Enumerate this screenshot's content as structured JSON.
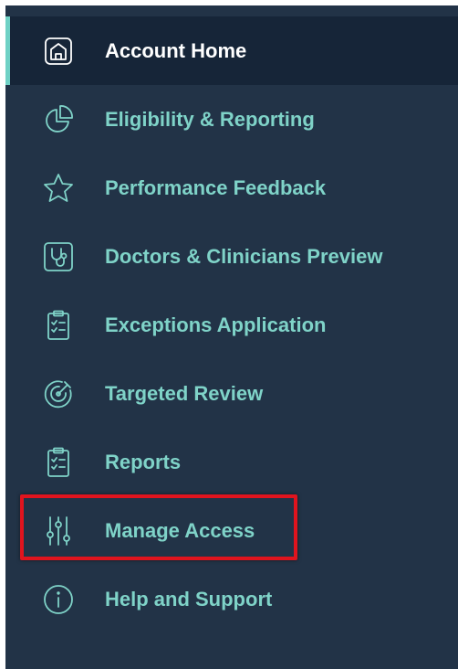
{
  "nav": {
    "items": [
      {
        "label": "Account Home",
        "icon": "home-icon",
        "active": true
      },
      {
        "label": "Eligibility & Reporting",
        "icon": "pie-chart-icon"
      },
      {
        "label": "Performance Feedback",
        "icon": "star-icon"
      },
      {
        "label": "Doctors & Clinicians Preview",
        "icon": "stethoscope-icon"
      },
      {
        "label": "Exceptions Application",
        "icon": "clipboard-icon"
      },
      {
        "label": "Targeted Review",
        "icon": "target-icon"
      },
      {
        "label": "Reports",
        "icon": "clipboard-icon"
      },
      {
        "label": "Manage Access",
        "icon": "sliders-icon",
        "highlighted": true
      },
      {
        "label": "Help and Support",
        "icon": "info-icon"
      }
    ]
  },
  "colors": {
    "background": "#223347",
    "active_background": "#162538",
    "accent": "#7fd3c8",
    "highlight": "#e0141e"
  }
}
